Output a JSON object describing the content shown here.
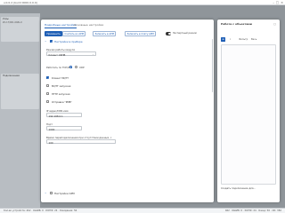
{
  "window": {
    "title": "v.0.0.2 (build 0000.0.0.0)"
  },
  "left_pane": {
    "card1_title": "Узлы",
    "card1_field": "ZC-17/001-00ZL-0",
    "card2_title": "Подключения"
  },
  "dialog": {
    "tabs": [
      {
        "label": "Подробные настройки"
      },
      {
        "label": "Основные настройки"
      }
    ],
    "toolbar": {
      "apply": "Применить",
      "from_device": "Считать из АРМ",
      "to_device": "Записать в АРМ",
      "write_device": "Записать в плату АРМ",
      "expert_toggle": "Экспертный режим"
    },
    "section1": "Настройки в приборе",
    "mode_label": "Режим работы модуля",
    "mode_value": "Клиент CRHB",
    "proto_label": "Работать по TCP/IP",
    "proto_udp": "UDP",
    "opts": [
      {
        "label": "Клиент MQTT",
        "checked": true
      },
      {
        "label": "MQTT запуская",
        "checked": false
      },
      {
        "label": "HTTP запуская",
        "checked": false
      },
      {
        "label": "Отправка \"PMB\"",
        "checked": false
      }
    ],
    "ip_label": "IP адрес/DNS имя",
    "ip_value": "192.168.0.1",
    "port_label": "Порт",
    "port_value": "1000",
    "timeout_label": "Время переподключения при отсутствии данных, с",
    "timeout_value": "100",
    "section2": "Настройки АРМ"
  },
  "right_panel": {
    "title": "Работа с объектами",
    "tools": [
      {
        "icon": "list-icon",
        "glyph": "≡"
      },
      {
        "icon": "info-icon",
        "glyph": "i"
      }
    ],
    "tool_labels": [
      "Фильтр",
      "Весь"
    ],
    "footer": "Создать подключение для..."
  },
  "status": {
    "left": "Кол-во устройств: 462 · ОШИБ: 0 · КОНФ: 24 · Ожидание: 56",
    "right": "462 · ОШИБ: 0 · КОНФ: 24 · Ожид: 56 · ОК: 382"
  }
}
